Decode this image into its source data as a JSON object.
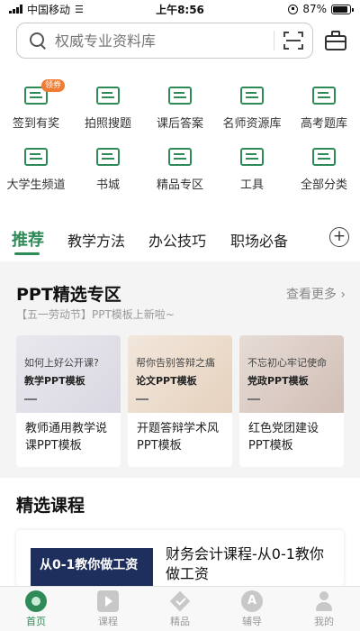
{
  "status_bar": {
    "carrier": "中国移动",
    "time": "上午8:56",
    "battery": "87%",
    "battery_level": 0.87
  },
  "header": {
    "search_placeholder": "权威专业资料库",
    "icons": [
      "search-icon",
      "scan-icon",
      "briefcase-icon"
    ]
  },
  "shortcuts": [
    {
      "label": "签到有奖",
      "badge": "领券",
      "icon": "document-icon"
    },
    {
      "label": "拍照搜题",
      "icon": "document-icon"
    },
    {
      "label": "课后答案",
      "icon": "document-icon"
    },
    {
      "label": "名师资源库",
      "icon": "document-icon"
    },
    {
      "label": "高考题库",
      "icon": "document-icon"
    },
    {
      "label": "大学生频道",
      "icon": "document-icon"
    },
    {
      "label": "书城",
      "icon": "document-icon"
    },
    {
      "label": "精品专区",
      "icon": "document-icon"
    },
    {
      "label": "工具",
      "icon": "document-icon"
    },
    {
      "label": "全部分类",
      "icon": "document-icon"
    }
  ],
  "tabs": [
    {
      "label": "推荐",
      "active": true
    },
    {
      "label": "教学方法",
      "active": false
    },
    {
      "label": "办公技巧",
      "active": false
    },
    {
      "label": "职场必备",
      "active": false
    }
  ],
  "add_tab_label": "+",
  "ppt_section": {
    "title": "PPT精选专区",
    "see_more": "查看更多",
    "subtitle": "【五一劳动节】PPT模板上新啦~",
    "cards": [
      {
        "thumb_line1": "如何上好公开课?",
        "thumb_line2": "教学PPT模板",
        "title": "教师通用教学说课PPT模板"
      },
      {
        "thumb_line1": "帮你告别答辩之痛",
        "thumb_line2": "论文PPT模板",
        "title": "开题答辩学术风PPT模板"
      },
      {
        "thumb_line1": "不忘初心牢记使命",
        "thumb_line2": "党政PPT模板",
        "title": "红色党团建设PPT模板"
      }
    ]
  },
  "courses_section": {
    "title": "精选课程",
    "course": {
      "thumb_text": "从0-1教你做工资",
      "title": "财务会计课程-从0-1教你做工资"
    }
  },
  "bottom_nav": [
    {
      "label": "首页",
      "icon": "home-icon",
      "active": true
    },
    {
      "label": "课程",
      "icon": "play-icon",
      "active": false
    },
    {
      "label": "精品",
      "icon": "gem-icon",
      "active": false
    },
    {
      "label": "辅导",
      "icon": "tutor-icon",
      "active": false,
      "icon_text": "A"
    },
    {
      "label": "我的",
      "icon": "profile-icon",
      "active": false
    }
  ],
  "colors": {
    "accent": "#2e8b57",
    "badge": "#f07c33",
    "course_thumb": "#1e2f5e"
  }
}
